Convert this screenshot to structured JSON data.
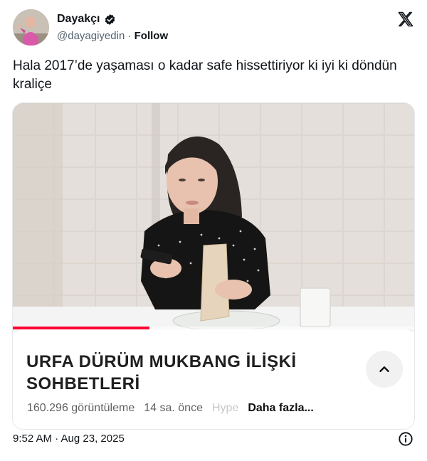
{
  "author": {
    "display_name": "Dayakçı",
    "handle": "@dayagiyedin",
    "separator": "·",
    "follow_label": "Follow"
  },
  "tweet": {
    "text": "Hala 2017’de yaşaması o kadar safe hissettiriyor ki iyi ki döndün kraliçe",
    "timestamp": "9:52 AM · Aug 23, 2025"
  },
  "video_card": {
    "title": "URFA DÜRÜM MUKBANG İLİŞKİ SOHBETLERİ",
    "views": "160.296 görüntüleme",
    "age": "14 sa. önce",
    "truncated_tag": "Hype",
    "more_label": "Daha fazla...",
    "progress_fraction": 0.34
  },
  "icons": {
    "verified": "verified-badge-icon",
    "brand": "x-logo-icon",
    "collapse": "chevron-up-icon",
    "info": "info-icon"
  },
  "colors": {
    "progress": "#ff0033",
    "text_primary": "#0f1419",
    "text_secondary": "#536471"
  }
}
